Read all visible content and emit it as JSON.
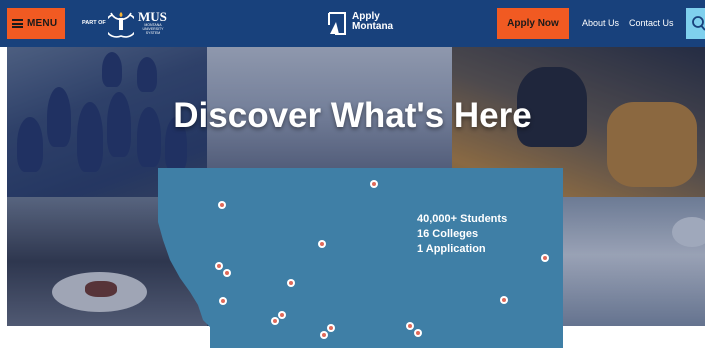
{
  "header": {
    "menu_label": "MENU",
    "part_of": "PART OF",
    "mus_title": "MUS",
    "mus_subtitle": "MONTANA UNIVERSITY SYSTEM",
    "apply_logo_line1": "Apply",
    "apply_logo_line2": "Montana",
    "apply_now_label": "Apply Now",
    "nav": [
      "About Us",
      "Contact Us"
    ],
    "icons": [
      "hamburger-icon",
      "mus-emblem-icon",
      "apply-montana-logo-icon",
      "search-icon"
    ]
  },
  "hero": {
    "title": "Discover What's Here",
    "stats": [
      "40,000+ Students",
      "16 Colleges",
      "1 Application"
    ]
  },
  "colors": {
    "header_bg": "#18417c",
    "accent_orange": "#f15a22",
    "map_blue": "#3f7fa6",
    "dot_red": "#e06a5a",
    "search_bg": "#7fd0ee"
  }
}
